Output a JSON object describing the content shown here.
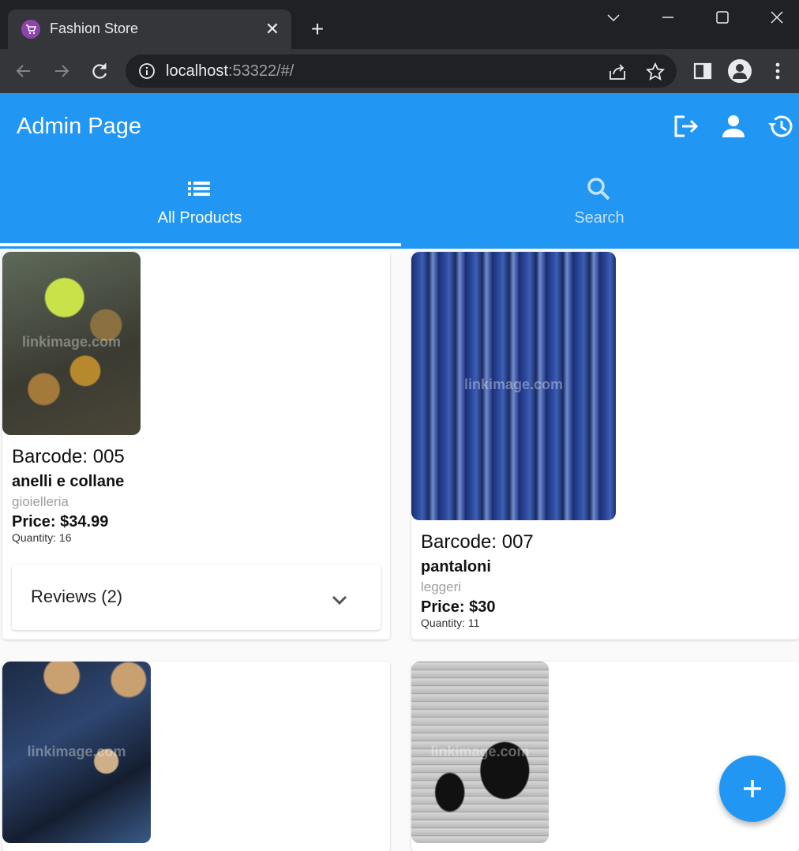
{
  "browser": {
    "tab_title": "Fashion Store",
    "url_host": "localhost",
    "url_rest": ":53322/#/"
  },
  "app": {
    "title": "Admin Page",
    "actions": [
      "logout-icon",
      "person-icon",
      "history-icon"
    ],
    "tabs": [
      {
        "label": "All Products",
        "icon": "list-icon",
        "active": true
      },
      {
        "label": "Search",
        "icon": "search-icon",
        "active": false
      }
    ],
    "accent_color": "#2196f3"
  },
  "products": [
    {
      "barcode": "Barcode: 005",
      "name": "anelli e collane",
      "category": "gioielleria",
      "price": "Price: $34.99",
      "quantity": "Quantity: 16",
      "reviews": "Reviews (2)",
      "watermark": "linkimage.com"
    },
    {
      "barcode": "Barcode: 007",
      "name": "pantaloni",
      "category": "leggeri",
      "price": "Price: $30",
      "quantity": "Quantity: 11",
      "watermark": "linkimage.com"
    },
    {
      "watermark": "linkimage.com"
    },
    {
      "watermark": "linkimage.com"
    }
  ]
}
